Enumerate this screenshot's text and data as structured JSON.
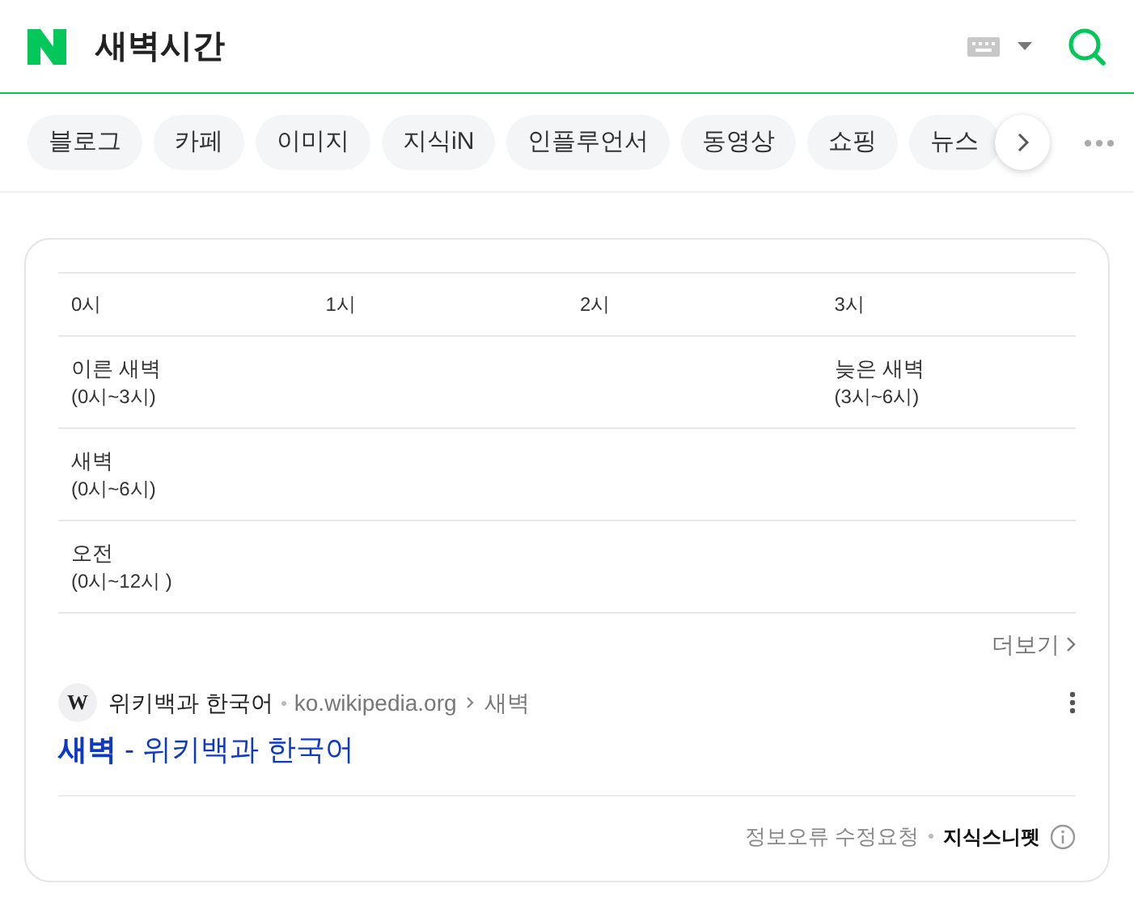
{
  "search": {
    "query": "새벽시간"
  },
  "tabs": [
    {
      "label": "블로그",
      "selected": false
    },
    {
      "label": "카페",
      "selected": false
    },
    {
      "label": "이미지",
      "selected": false
    },
    {
      "label": "지식iN",
      "selected": false
    },
    {
      "label": "인플루언서",
      "selected": false
    },
    {
      "label": "동영상",
      "selected": false
    },
    {
      "label": "쇼핑",
      "selected": false
    },
    {
      "label": "뉴스",
      "selected": false
    }
  ],
  "table": {
    "columns": [
      "0시",
      "1시",
      "2시",
      "3시"
    ],
    "rows": [
      [
        {
          "title": "이른 새벽",
          "range": "(0시~3시)"
        },
        null,
        null,
        {
          "title": "늦은 새벽",
          "range": "(3시~6시)"
        }
      ],
      [
        {
          "title": "새벽",
          "range": "(0시~6시)"
        },
        null,
        null,
        null
      ],
      [
        {
          "title": "오전",
          "range": "(0시~12시 )"
        },
        null,
        null,
        null
      ]
    ]
  },
  "more_link": "더보기",
  "source": {
    "site": "위키백과 한국어",
    "domain": "ko.wikipedia.org",
    "path": "새벽",
    "favicon": "W"
  },
  "result_title": "**새벽** - 위키백과 한국어",
  "footer": {
    "report": "정보오류 수정요청",
    "brand": "지식스니펫"
  }
}
